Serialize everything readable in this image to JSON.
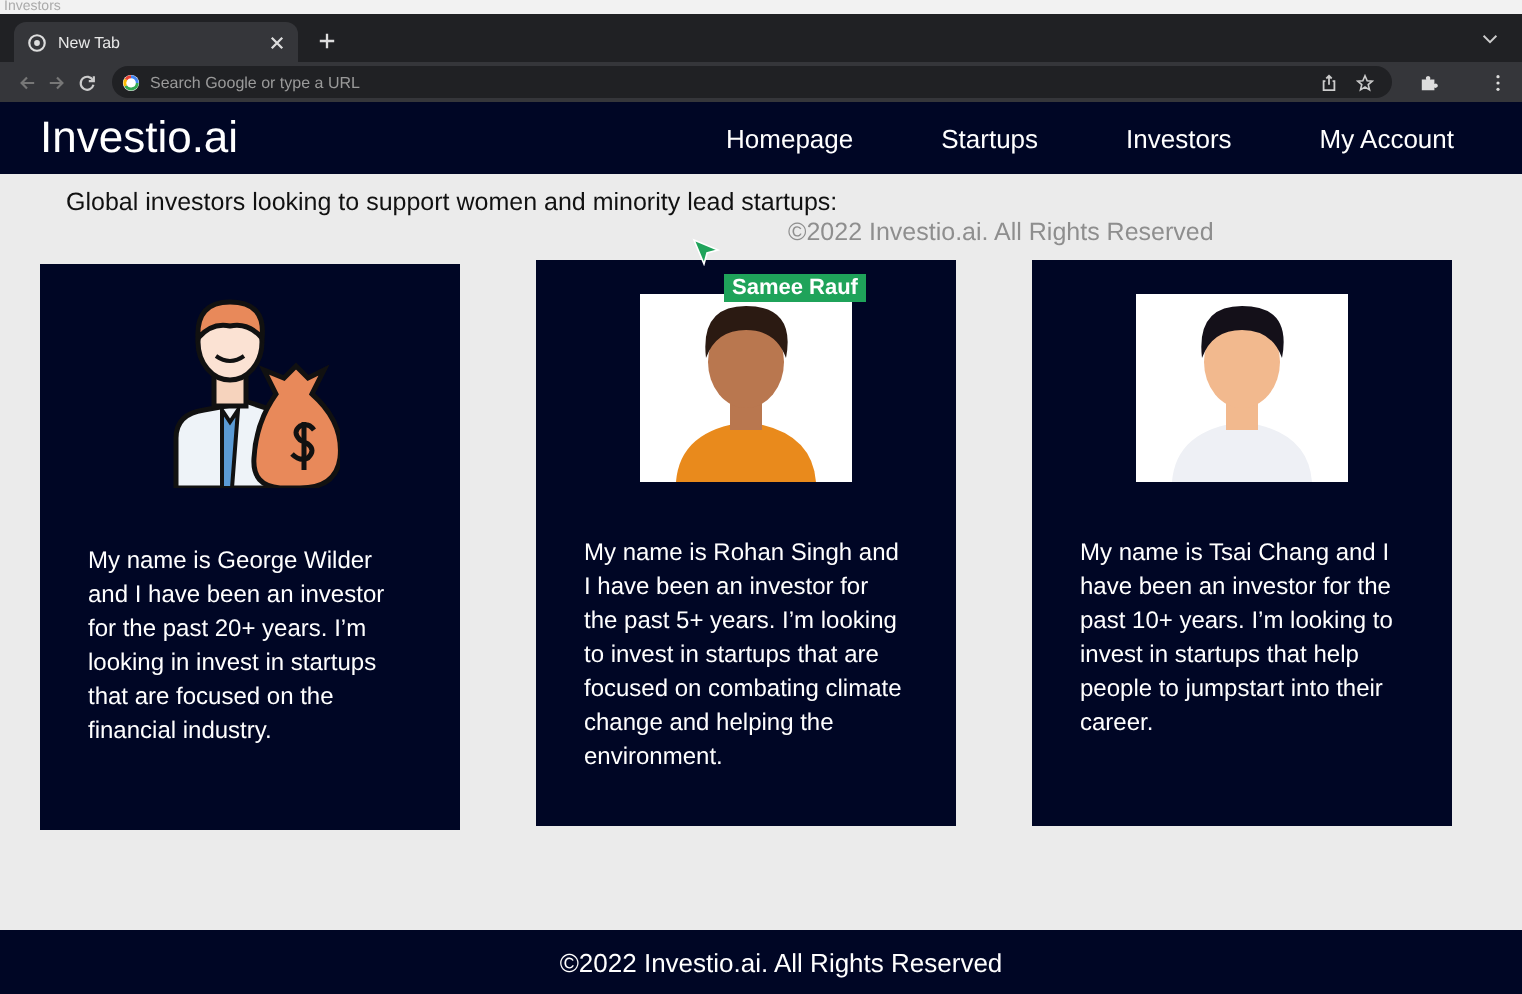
{
  "page_title": "Investors",
  "browser": {
    "tab": {
      "title": "New Tab"
    },
    "address_bar": {
      "placeholder": "Search Google or type a URL"
    }
  },
  "navbar": {
    "logo": "Investio.ai",
    "links": [
      {
        "label": "Homepage"
      },
      {
        "label": "Startups"
      },
      {
        "label": "Investors"
      },
      {
        "label": "My Account"
      }
    ]
  },
  "intro": "Global investors looking to support women and minority lead startups:",
  "ghost_text": "©2022 Investio.ai. All Rights Reserved",
  "cursor": {
    "label": "Samee Rauf"
  },
  "investors": [
    {
      "kind": "icon",
      "bio": "My name is George Wilder and I have been an investor for the past 20+ years. I’m looking in invest in startups that are focused on the financial industry."
    },
    {
      "kind": "avatar",
      "bio": "My name is Rohan Singh and I have been an investor for the past 5+ years. I’m looking to invest in startups that are focused on combating climate change and helping the environment."
    },
    {
      "kind": "avatar",
      "bio": "My name is Tsai Chang and I have been an investor for the past 10+ years. I’m looking to invest in startups that help people to jumpstart into their career."
    }
  ],
  "footer": "©2022 Investio.ai. All Rights Reserved"
}
